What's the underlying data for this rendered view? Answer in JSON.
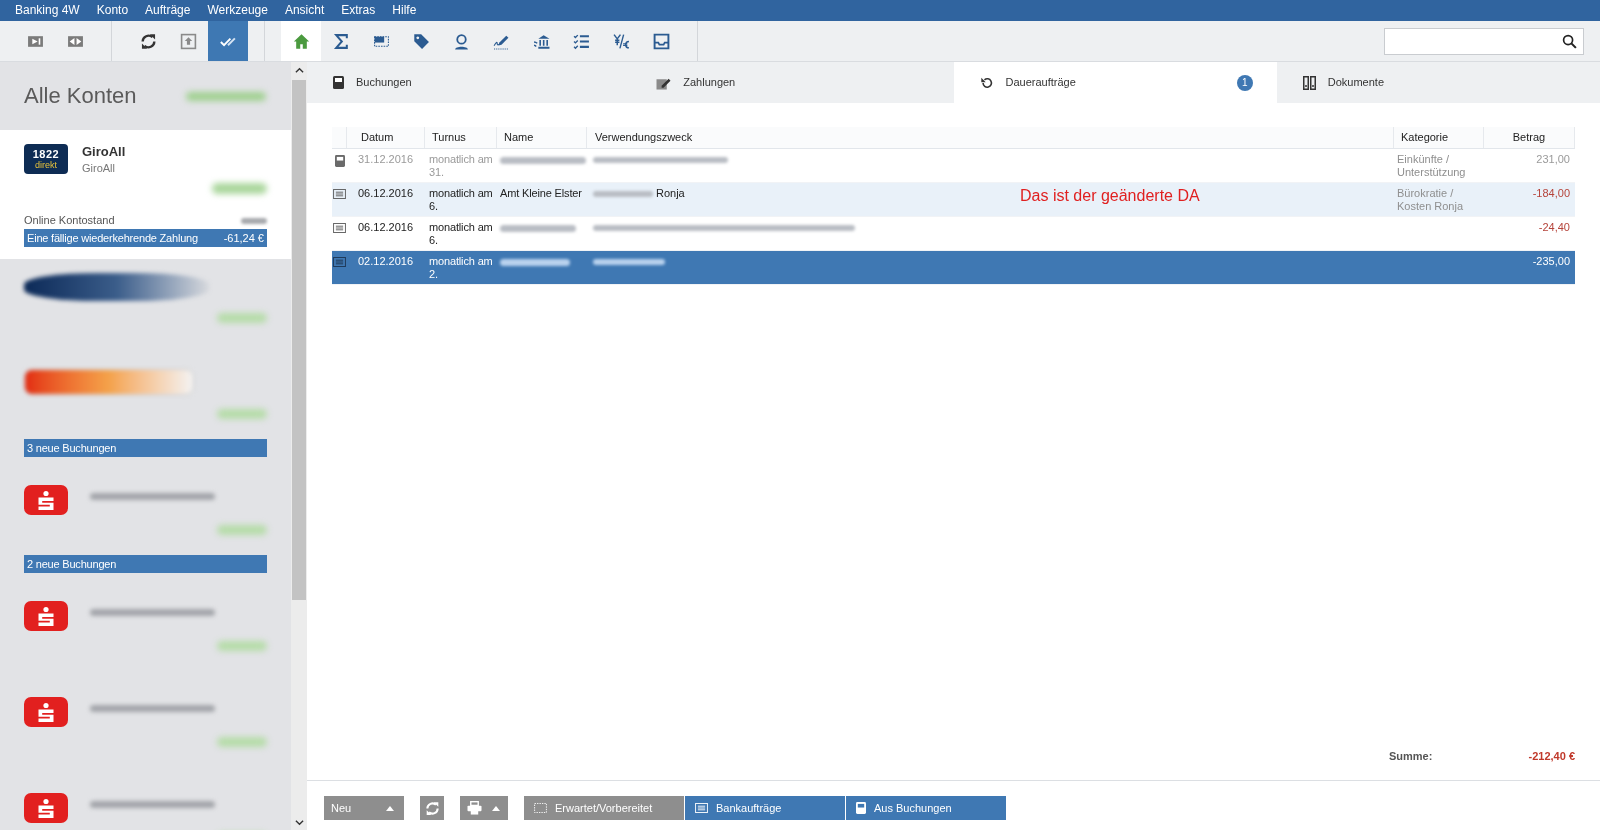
{
  "menu": [
    "Banking 4W",
    "Konto",
    "Aufträge",
    "Werkzeuge",
    "Ansicht",
    "Extras",
    "Hilfe"
  ],
  "toolbar": {
    "groups": [
      [
        {
          "selected": false
        },
        {
          "selected": false
        }
      ],
      [
        {
          "selected": false
        },
        {
          "selected": false
        },
        {
          "selected": true
        }
      ],
      [
        {
          "selected": true
        },
        {
          "selected": false
        },
        {
          "selected": false
        },
        {
          "selected": false
        },
        {
          "selected": false
        },
        {
          "selected": false
        },
        {
          "selected": false
        },
        {
          "selected": false
        },
        {
          "selected": false
        },
        {
          "selected": false
        }
      ]
    ]
  },
  "sidebar": {
    "title": "Alle Konten",
    "accounts": [
      {
        "selected": true,
        "logo": {
          "kind": "wordmark",
          "lines": [
            "1822",
            "direkt"
          ]
        },
        "name": "GiroAll",
        "subtitle": "GiroAll",
        "balance_label": "Online Kontostand",
        "notice": {
          "label": "Eine fällige wiederkehrende Zahlung",
          "amount": "-61,24 €"
        }
      },
      {
        "selected": false,
        "logo": {
          "kind": "dark"
        }
      },
      {
        "selected": false,
        "logo": {
          "kind": "warm"
        },
        "notice": {
          "label": "3 neue Buchungen"
        }
      },
      {
        "selected": false,
        "logo": {
          "kind": "symbol"
        },
        "notice": {
          "label": "2 neue Buchungen"
        }
      },
      {
        "selected": false,
        "logo": {
          "kind": "symbol"
        }
      },
      {
        "selected": false,
        "logo": {
          "kind": "symbol"
        }
      },
      {
        "selected": false,
        "logo": {
          "kind": "symbol"
        }
      }
    ]
  },
  "tabs": [
    {
      "label": "Buchungen",
      "selected": false
    },
    {
      "label": "Zahlungen",
      "selected": false
    },
    {
      "label": "Daueraufträge",
      "selected": true,
      "badge": "1"
    },
    {
      "label": "Dokumente",
      "selected": false
    }
  ],
  "table": {
    "columns": [
      "Datum",
      "Turnus",
      "Name",
      "Verwendungszweck",
      "Kategorie",
      "Betrag"
    ],
    "rows": [
      {
        "kind": "booked",
        "selected": false,
        "highlighted": false,
        "date": "31.12.2016",
        "interval": "monatlich am 31.",
        "name": {
          "blurred": true
        },
        "purpose": {
          "blurred": true
        },
        "category": "Einkünfte / Unterstützung",
        "amount": "231,00"
      },
      {
        "kind": "order",
        "selected": false,
        "highlighted": true,
        "date": "06.12.2016",
        "interval": "monatlich am 6.",
        "name": {
          "text": "Amt Kleine Elster",
          "blurred": false
        },
        "purpose": {
          "text": "Ronja",
          "blurred": true
        },
        "category": "Bürokratie / Kosten Ronja",
        "amount": "-184,00"
      },
      {
        "kind": "order",
        "selected": false,
        "highlighted": false,
        "date": "06.12.2016",
        "interval": "monatlich am 6.",
        "name": {
          "blurred": true
        },
        "purpose": {
          "blurred": true
        },
        "amount": "-24,40"
      },
      {
        "kind": "order",
        "selected": true,
        "highlighted": false,
        "date": "02.12.2016",
        "interval": "monatlich am 2.",
        "name": {
          "blurred": true
        },
        "purpose": {
          "blurred": true
        },
        "amount": "-235,00"
      }
    ],
    "annotation": "Das ist der geänderte DA"
  },
  "summary": {
    "label": "Summe:",
    "value": "-212,40 €"
  },
  "bottom_bar": {
    "buttons": [
      {
        "kind": "dropdown",
        "label": "Neu"
      },
      {
        "kind": "refresh"
      },
      {
        "kind": "print"
      },
      {
        "kind": "filter",
        "label": "Erwartet/Vorbereitet",
        "selected": false
      },
      {
        "kind": "filter",
        "label": "Bankaufträge",
        "selected": true
      },
      {
        "kind": "filter",
        "label": "Aus Buchungen",
        "selected": true
      }
    ]
  }
}
